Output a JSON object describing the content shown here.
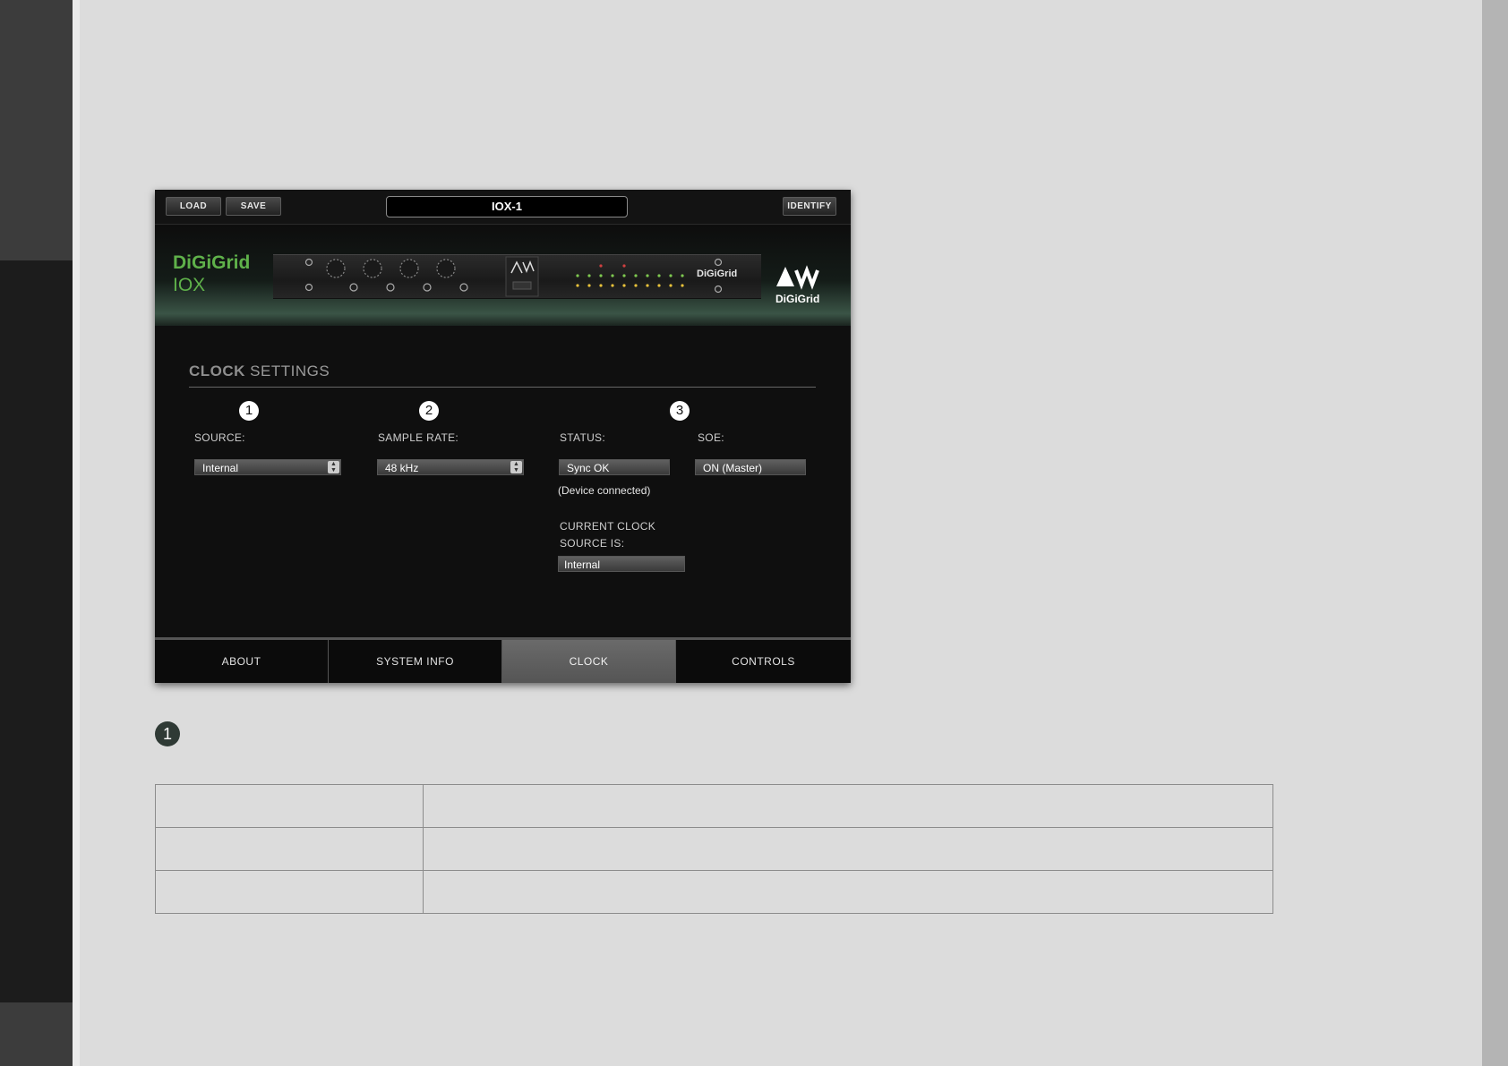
{
  "plugin": {
    "toolbar": {
      "load_label": "LOAD",
      "save_label": "SAVE",
      "identify_label": "IDENTIFY"
    },
    "device_name": "IOX-1",
    "brand": {
      "name": "DiGiGrid",
      "model": "IOX",
      "logo_text": "DiGiGrid",
      "device_logo_text": "DiGiGrid"
    },
    "clock": {
      "title_bold": "CLOCK",
      "title_rest": " SETTINGS",
      "badges": [
        "1",
        "2",
        "3"
      ],
      "source": {
        "label": "SOURCE:",
        "value": "Internal"
      },
      "sample_rate": {
        "label": "SAMPLE RATE:",
        "value": "48 kHz"
      },
      "status": {
        "label": "STATUS:",
        "value": "Sync OK",
        "note": "(Device connected)"
      },
      "soe": {
        "label": "SOE:",
        "value": "ON (Master)"
      },
      "current_source": {
        "label_line1": "CURRENT CLOCK",
        "label_line2": "SOURCE IS:",
        "value": "Internal"
      }
    },
    "tabs": [
      {
        "label": "ABOUT",
        "active": false
      },
      {
        "label": "SYSTEM INFO",
        "active": false
      },
      {
        "label": "CLOCK",
        "active": true
      },
      {
        "label": "CONTROLS",
        "active": false
      }
    ]
  },
  "doc": {
    "badge": "1"
  },
  "colors": {
    "brand_green": "#5fb14a",
    "page_bg": "#dcdcdc",
    "panel_bg": "#0f0f0f",
    "badge_dark": "#2f3a35"
  }
}
